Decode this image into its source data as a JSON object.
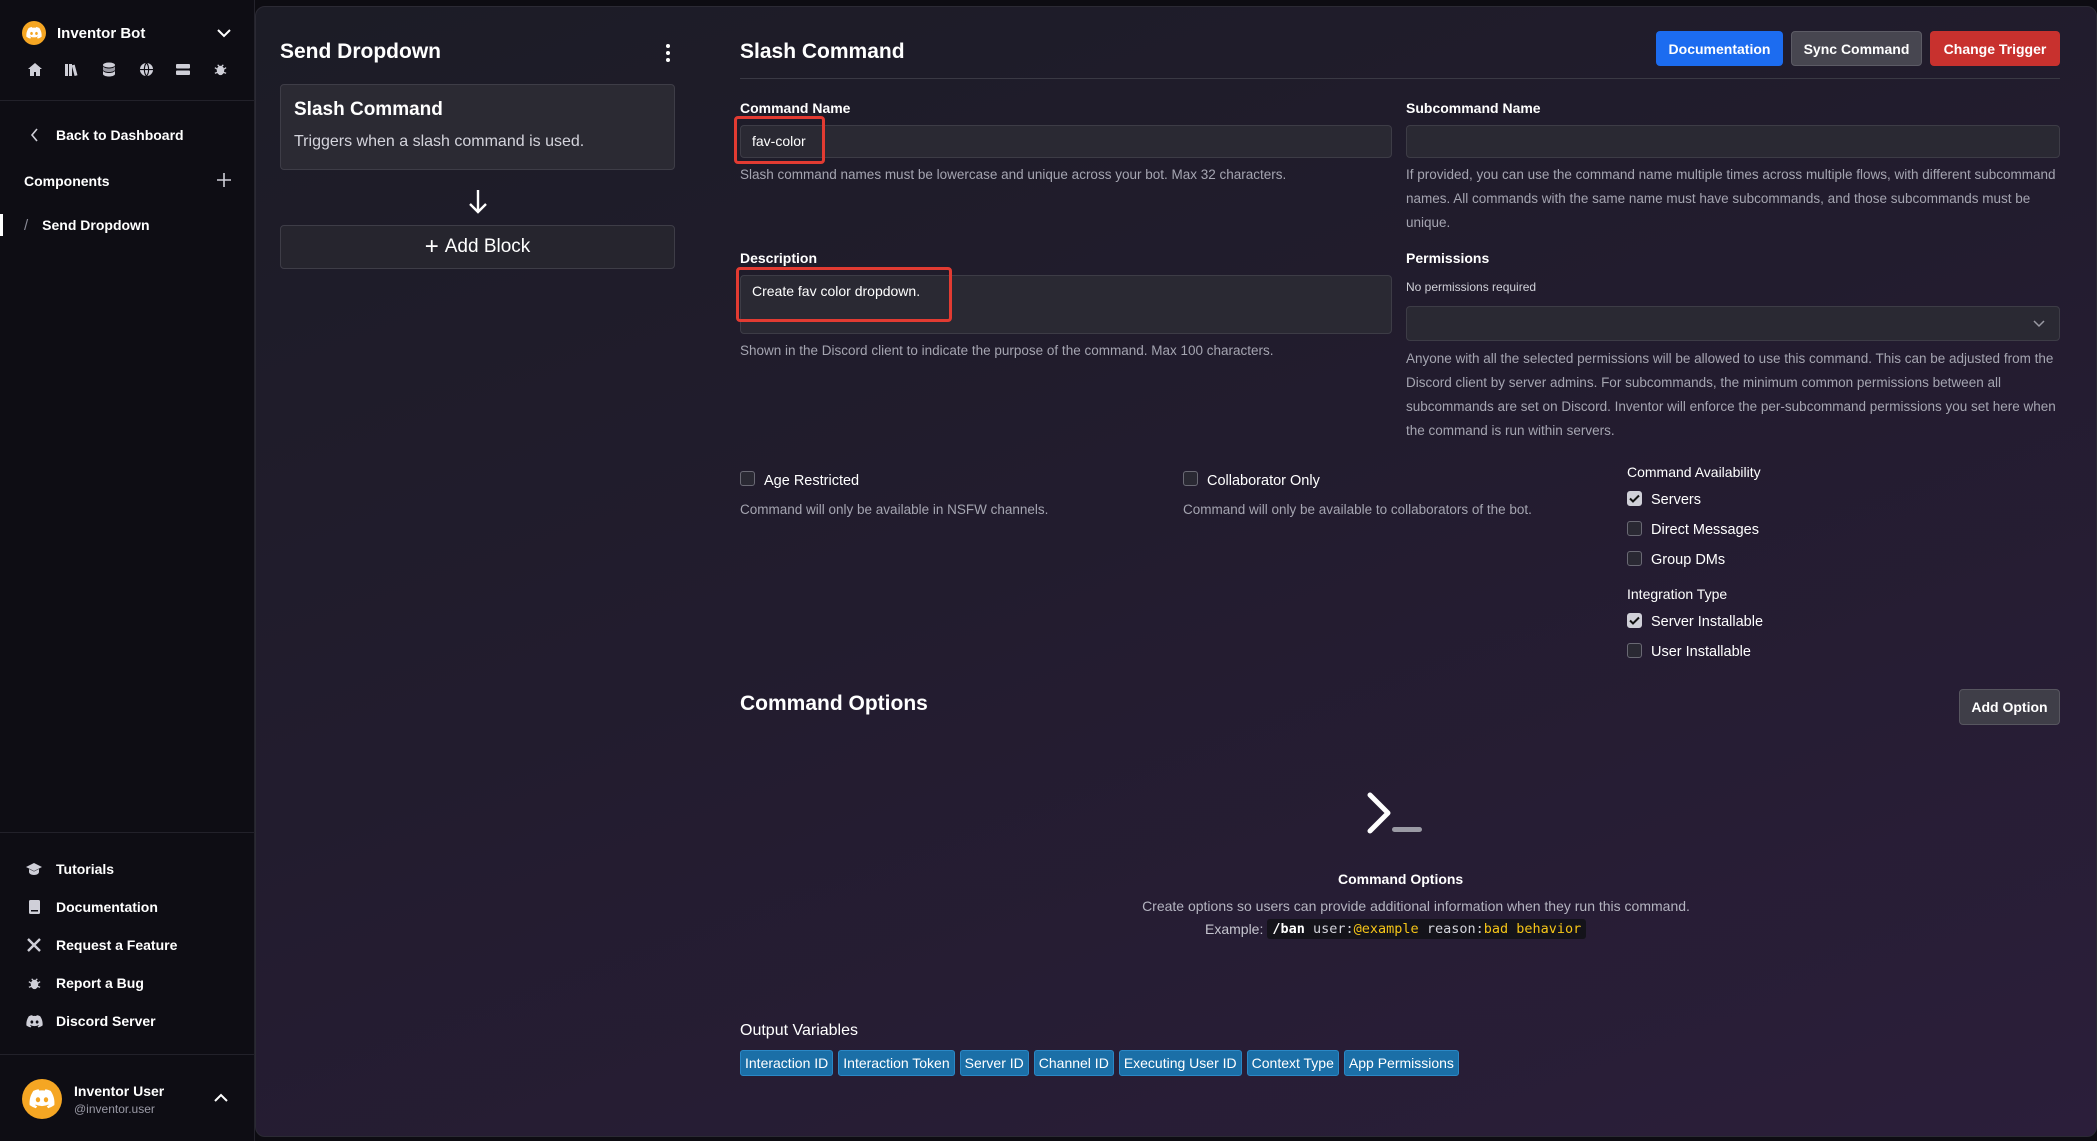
{
  "sidebar": {
    "bot_name": "Inventor Bot",
    "icons": [
      "home-icon",
      "library-icon",
      "database-icon",
      "globe-icon",
      "server-icon",
      "bug-icon"
    ],
    "back_label": "Back to Dashboard",
    "components_label": "Components",
    "active_item": "Send Dropdown",
    "bottom_links": [
      {
        "label": "Tutorials",
        "icon": "graduation-cap-icon"
      },
      {
        "label": "Documentation",
        "icon": "book-icon"
      },
      {
        "label": "Request a Feature",
        "icon": "tools-icon"
      },
      {
        "label": "Report a Bug",
        "icon": "bug-icon"
      },
      {
        "label": "Discord Server",
        "icon": "discord-icon"
      }
    ],
    "user": {
      "name": "Inventor User",
      "handle": "@inventor.user"
    }
  },
  "flow_panel": {
    "title": "Send Dropdown",
    "trigger_title": "Slash Command",
    "trigger_desc": "Triggers when a slash command is used.",
    "add_block_label": "Add Block"
  },
  "form": {
    "title": "Slash Command",
    "buttons": {
      "documentation": "Documentation",
      "sync": "Sync Command",
      "change": "Change Trigger"
    },
    "command_name": {
      "label": "Command Name",
      "value": "fav-color",
      "help": "Slash command names must be lowercase and unique across your bot. Max 32 characters."
    },
    "subcommand_name": {
      "label": "Subcommand Name",
      "value": "",
      "help": "If provided, you can use the command name multiple times across multiple flows, with different subcommand names. All commands with the same name must have subcommands, and those subcommands must be unique."
    },
    "description": {
      "label": "Description",
      "value": "Create fav color dropdown.",
      "help": "Shown in the Discord client to indicate the purpose of the command. Max 100 characters."
    },
    "permissions": {
      "label": "Permissions",
      "note": "No permissions required",
      "help": "Anyone with all the selected permissions will be allowed to use this command. This can be adjusted from the Discord client by server admins. For subcommands, the minimum common permissions between all subcommands are set on Discord. Inventor will enforce the per-subcommand permissions you set here when the command is run within servers."
    },
    "age_restricted": {
      "label": "Age Restricted",
      "checked": false,
      "help": "Command will only be available in NSFW channels."
    },
    "collaborator_only": {
      "label": "Collaborator Only",
      "checked": false,
      "help": "Command will only be available to collaborators of the bot."
    },
    "availability": {
      "title": "Command Availability",
      "options": [
        {
          "label": "Servers",
          "checked": true
        },
        {
          "label": "Direct Messages",
          "checked": false
        },
        {
          "label": "Group DMs",
          "checked": false
        }
      ]
    },
    "integration": {
      "title": "Integration Type",
      "options": [
        {
          "label": "Server Installable",
          "checked": true
        },
        {
          "label": "User Installable",
          "checked": false
        }
      ]
    }
  },
  "options_section": {
    "title": "Command Options",
    "add_label": "Add Option",
    "empty_title": "Command Options",
    "empty_desc": "Create options so users can provide additional information when they run this command.",
    "example_label": "Example:",
    "example_cmd": "/ban",
    "example_k1": "user:",
    "example_v1": "@example",
    "example_k2": "reason:",
    "example_v2": "bad behavior"
  },
  "output": {
    "title": "Output Variables",
    "chips": [
      "Interaction ID",
      "Interaction Token",
      "Server ID",
      "Channel ID",
      "Executing User ID",
      "Context Type",
      "App Permissions"
    ]
  },
  "colors": {
    "accent_blue": "#1c6cf0",
    "danger_red": "#c8312e",
    "chip_blue": "#1b6fa7",
    "highlight": "#e23b32",
    "avatar": "#f5a623"
  }
}
